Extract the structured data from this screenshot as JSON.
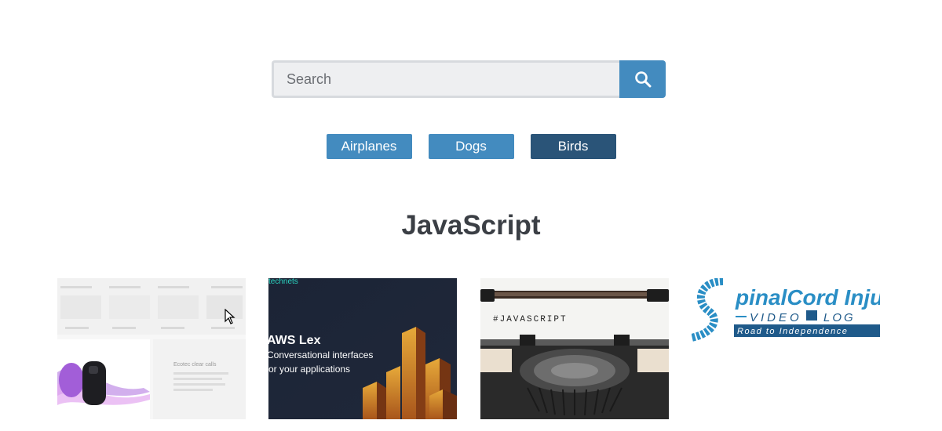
{
  "search": {
    "placeholder": "Search",
    "value": "",
    "button_icon": "search-icon"
  },
  "nav": {
    "buttons": [
      {
        "label": "Airplanes",
        "active": false
      },
      {
        "label": "Dogs",
        "active": false
      },
      {
        "label": "Birds",
        "active": true
      }
    ]
  },
  "section": {
    "title": "JavaScript"
  },
  "gallery": {
    "items": [
      {
        "description": "earbuds-product-page",
        "text": {
          "line1": "Ecotec clear calls"
        }
      },
      {
        "description": "aws-lex-banner",
        "text": {
          "brand": "technets",
          "title": "AWS Lex",
          "line1": "Conversational interfaces",
          "line2": "or your applications"
        }
      },
      {
        "description": "typewriter-javascript",
        "text": {
          "paper": "#JAVASCRIPT"
        }
      },
      {
        "description": "spinal-cord-injury-video-blog",
        "text": {
          "title": "pinalCord Injur",
          "subtitle": "VIDEO",
          "subtitle2": "LOG",
          "tagline": "Road to Independence"
        }
      }
    ]
  },
  "colors": {
    "accent": "#438bbf",
    "active": "#2a5478",
    "title": "#3b3f45"
  }
}
